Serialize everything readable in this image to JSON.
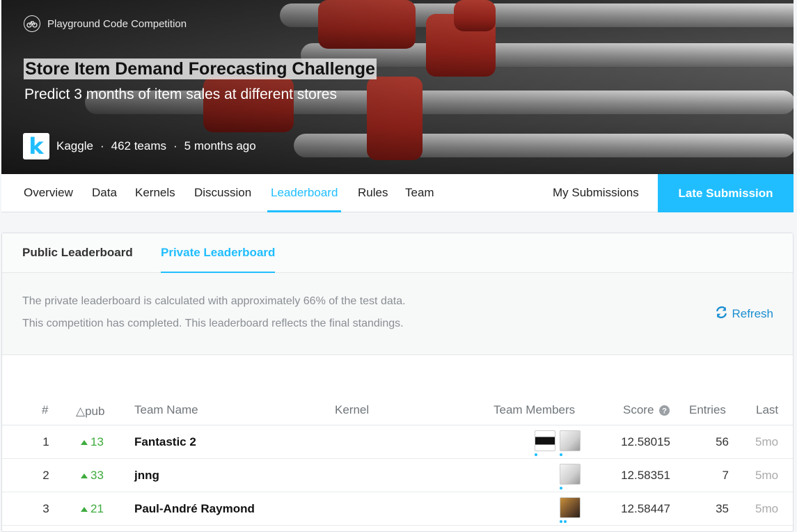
{
  "hero": {
    "competition_type": "Playground Code Competition",
    "title": "Store Item Demand Forecasting Challenge",
    "subtitle": "Predict 3 months of item sales at different stores",
    "host": "Kaggle",
    "teams": "462 teams",
    "age": "5 months ago",
    "logo_letter": "k"
  },
  "nav": {
    "tabs": [
      "Overview",
      "Data",
      "Kernels",
      "Discussion",
      "Leaderboard",
      "Rules",
      "Team"
    ],
    "active_tab": "Leaderboard",
    "my_submissions": "My Submissions",
    "late_submission": "Late Submission"
  },
  "leaderboard": {
    "subtabs": [
      "Public Leaderboard",
      "Private Leaderboard"
    ],
    "active_subtab": "Private Leaderboard",
    "info_line1": "The private leaderboard is calculated with approximately 66% of the test data.",
    "info_line2": "This competition has completed. This leaderboard reflects the final standings.",
    "refresh_label": "Refresh",
    "columns": {
      "rank": "#",
      "delta": "△pub",
      "team_name": "Team Name",
      "kernel": "Kernel",
      "team_members": "Team Members",
      "score": "Score",
      "entries": "Entries",
      "last": "Last"
    },
    "rows": [
      {
        "rank": "1",
        "delta": "13",
        "team": "Fantastic 2",
        "score": "12.58015",
        "entries": "56",
        "last": "5mo"
      },
      {
        "rank": "2",
        "delta": "33",
        "team": "jnng",
        "score": "12.58351",
        "entries": "7",
        "last": "5mo"
      },
      {
        "rank": "3",
        "delta": "21",
        "team": "Paul-André Raymond",
        "score": "12.58447",
        "entries": "35",
        "last": "5mo"
      }
    ]
  },
  "colors": {
    "accent": "#20beff",
    "positive": "#3eab3e"
  }
}
